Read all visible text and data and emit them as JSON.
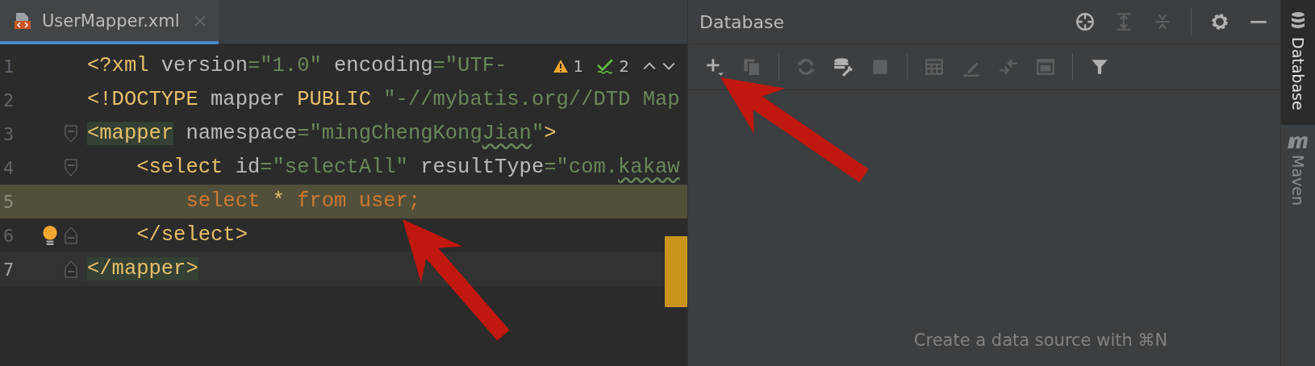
{
  "tab": {
    "title": "UserMapper.xml",
    "selected": true
  },
  "editor": {
    "inspections": {
      "warnings": "1",
      "weak_warnings": "2"
    },
    "lines": [
      {
        "number": "1",
        "current": false,
        "highlighted": false,
        "fold_start": false,
        "fold_end": false,
        "bulb": false,
        "tokens": [
          {
            "kind": "tag",
            "t": "<?xml"
          },
          {
            "kind": "text",
            "t": " version"
          },
          {
            "kind": "string",
            "t": "=\"1.0\""
          },
          {
            "kind": "text",
            "t": " encoding"
          },
          {
            "kind": "string",
            "t": "=\"UTF-"
          }
        ]
      },
      {
        "number": "2",
        "current": false,
        "highlighted": false,
        "fold_start": false,
        "fold_end": false,
        "bulb": false,
        "tokens": [
          {
            "kind": "tag",
            "t": "<!DOCTYPE"
          },
          {
            "kind": "text",
            "t": " mapper "
          },
          {
            "kind": "tag",
            "t": "PUBLIC"
          },
          {
            "kind": "string",
            "t": " \"-//mybatis.org//DTD Map"
          }
        ]
      },
      {
        "number": "3",
        "current": false,
        "highlighted": false,
        "fold_start": true,
        "fold_end": false,
        "bulb": false,
        "tokens": [
          {
            "kind": "tag",
            "t": "<mapper",
            "matched": true
          },
          {
            "kind": "text",
            "t": " namespace"
          },
          {
            "kind": "string",
            "t": "=\"mingChengKong"
          },
          {
            "kind": "string",
            "t": "Jian",
            "typo": true
          },
          {
            "kind": "string",
            "t": "\""
          },
          {
            "kind": "tag",
            "t": ">"
          }
        ]
      },
      {
        "number": "4",
        "current": false,
        "highlighted": false,
        "fold_start": true,
        "fold_end": false,
        "bulb": false,
        "tokens": [
          {
            "kind": "tag",
            "t": "    <select"
          },
          {
            "kind": "text",
            "t": " id"
          },
          {
            "kind": "string",
            "t": "=\"selectAll\""
          },
          {
            "kind": "text",
            "t": " resultType"
          },
          {
            "kind": "string",
            "t": "=\"com."
          },
          {
            "kind": "string",
            "t": "kakaw",
            "typo": true
          }
        ]
      },
      {
        "number": "5",
        "current": false,
        "highlighted": true,
        "fold_start": false,
        "fold_end": false,
        "bulb": false,
        "tokens": [
          {
            "kind": "sql",
            "t": "        select"
          },
          {
            "kind": "op",
            "t": " * "
          },
          {
            "kind": "sql",
            "t": "from user;"
          }
        ]
      },
      {
        "number": "6",
        "current": false,
        "highlighted": false,
        "fold_start": false,
        "fold_end": true,
        "bulb": true,
        "tokens": [
          {
            "kind": "tag",
            "t": "    </select>"
          }
        ]
      },
      {
        "number": "7",
        "current": true,
        "highlighted": false,
        "fold_start": false,
        "fold_end": true,
        "bulb": false,
        "tokens": [
          {
            "kind": "tag",
            "t": "</mapper>",
            "matched": true
          }
        ]
      }
    ]
  },
  "database_panel": {
    "title": "Database",
    "header_groups": [
      [
        {
          "disabled": false
        },
        {
          "disabled": true
        },
        {
          "disabled": true
        }
      ],
      [
        {
          "disabled": false
        },
        {
          "disabled": false
        }
      ]
    ],
    "toolbar_groups": [
      [
        {
          "disabled": false
        },
        {
          "disabled": true
        }
      ],
      [
        {
          "disabled": true
        },
        {
          "disabled": false
        },
        {
          "disabled": true
        }
      ],
      [
        {
          "disabled": true
        },
        {
          "disabled": true
        },
        {
          "disabled": true
        },
        {
          "disabled": true
        }
      ],
      [
        {
          "disabled": false
        }
      ]
    ],
    "empty_text": "Create a data source with ⌘N"
  },
  "side_tabs": [
    {
      "label": "Database",
      "selected": true
    },
    {
      "label": "Maven",
      "selected": false
    }
  ],
  "annotations": [
    {
      "kind": "arrow"
    },
    {
      "kind": "arrow"
    }
  ]
}
